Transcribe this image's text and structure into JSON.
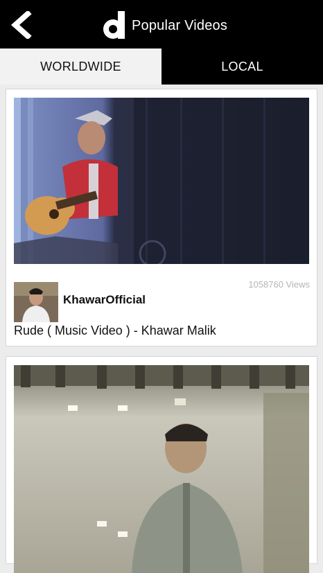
{
  "header": {
    "title": "Popular Videos",
    "back_icon": "back-arrow-icon",
    "logo": "d"
  },
  "tabs": [
    {
      "label": "WORLDWIDE",
      "active": true
    },
    {
      "label": "LOCAL",
      "active": false
    }
  ],
  "videos": [
    {
      "views": "1058760 Views",
      "channel": "KhawarOfficial",
      "title": "Rude ( Music Video ) - Khawar Malik"
    }
  ],
  "colors": {
    "bar": "#000000",
    "active_tab": "#f2f2f2",
    "background": "#ececec",
    "views_text": "#b5b5b5"
  }
}
